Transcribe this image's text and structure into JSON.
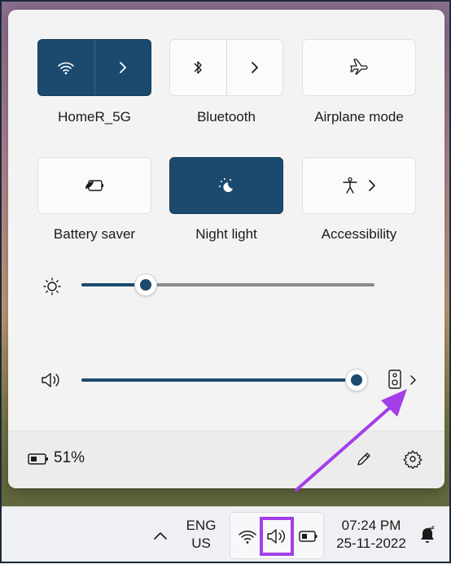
{
  "tiles": {
    "wifi": {
      "label": "HomeR_5G",
      "active": true
    },
    "bluetooth": {
      "label": "Bluetooth",
      "active": false
    },
    "airplane": {
      "label": "Airplane mode",
      "active": false
    },
    "battery_saver": {
      "label": "Battery saver",
      "active": false
    },
    "night_light": {
      "label": "Night light",
      "active": true
    },
    "accessibility": {
      "label": "Accessibility",
      "active": false
    }
  },
  "sliders": {
    "brightness": {
      "level_percent": 22
    },
    "volume": {
      "level_percent": 97
    }
  },
  "footer": {
    "battery_percent": "51%"
  },
  "taskbar": {
    "language_line1": "ENG",
    "language_line2": "US",
    "time": "07:24 PM",
    "date": "25-11-2022"
  },
  "colors": {
    "accent": "#1c4a6e",
    "highlight": "#a33ee8",
    "arrow": "#a33ee8"
  }
}
